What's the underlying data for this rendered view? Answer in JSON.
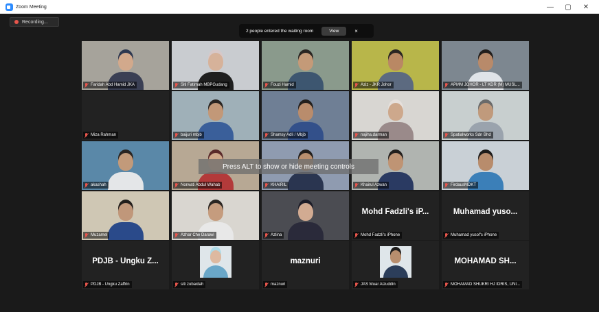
{
  "window": {
    "title": "Zoom Meeting",
    "controls": {
      "minimize": "—",
      "maximize": "▢",
      "close": "✕"
    }
  },
  "recording": {
    "label": "Recording..."
  },
  "waiting_notice": {
    "text": "2 people entered the waiting room",
    "view_label": "View",
    "close_label": "×"
  },
  "overlay": {
    "text": "Press ALT to show or hide meeting controls"
  },
  "participants": [
    {
      "name": "Faridah Abd Hamid JKA",
      "type": "video",
      "bg": "#a6a39b",
      "skin": "#d2a98c",
      "top": "#3a3f54",
      "head": "#2e3850"
    },
    {
      "name": "Siti Fatimah MBPGudang",
      "type": "video",
      "bg": "#c9ccd0",
      "skin": "#d6b29a",
      "top": "#1f1f1f",
      "head": "#d7c8c8"
    },
    {
      "name": "Fouzi Hamid",
      "type": "video",
      "bg": "#8a9a8c",
      "skin": "#c49a78",
      "top": "#3d5670",
      "head": "#2a2522"
    },
    {
      "name": "Aziz - JKR Johor",
      "type": "video",
      "bg": "#b8b64a",
      "skin": "#b98864",
      "top": "#5c6a80",
      "head": "#2a2522"
    },
    {
      "name": "APMM JOHOR - LT KDR (M) MUSL...",
      "type": "video",
      "bg": "#7d8790",
      "skin": "#b88a6a",
      "top": "#dfe3e8",
      "head": "#221e1c"
    },
    {
      "name": "Miza Rahman",
      "type": "blank"
    },
    {
      "name": "baijuri mbjb",
      "type": "video",
      "bg": "#9fb0b8",
      "skin": "#c29878",
      "top": "#3a5f9a",
      "head": "#2a2522"
    },
    {
      "name": "Shamsy Adli / Mbjb",
      "type": "video",
      "bg": "#6f7f95",
      "skin": "#b98c6c",
      "top": "#33508a",
      "head": "#231f1d"
    },
    {
      "name": "najiha.darman",
      "type": "video",
      "bg": "#d8d6d2",
      "skin": "#cda88c",
      "top": "#9a8a8a",
      "head": "#e6e0dc"
    },
    {
      "name": "Spatialworks Sdn Bhd",
      "type": "video",
      "bg": "#c8cfcf",
      "skin": "#c09a7c",
      "top": "#9aa3ad",
      "head": "#6a6a6a"
    },
    {
      "name": "akashah",
      "type": "video",
      "bg": "#5a88a8",
      "skin": "#c29a7a",
      "top": "#e4e6e8",
      "head": "#2a2522"
    },
    {
      "name": "Norwati Abdul Wahab",
      "type": "video",
      "bg": "#b7a894",
      "skin": "#cfa88a",
      "top": "#b33a3a",
      "head": "#5a2a2a"
    },
    {
      "name": "KHAIRIL",
      "type": "video",
      "bg": "#8f9bb0",
      "skin": "#b88e6e",
      "top": "#2a3550",
      "head": "#221e1c"
    },
    {
      "name": "Khairul Azwan",
      "type": "video",
      "bg": "#b0b4b0",
      "skin": "#bf9474",
      "top": "#2a3a62",
      "head": "#231f1d"
    },
    {
      "name": "FirdausMDKT",
      "type": "video",
      "bg": "#c9d0d6",
      "skin": "#b88c6c",
      "top": "#3b7fb8",
      "head": "#1e1c1b"
    },
    {
      "name": "Muzamel",
      "type": "video",
      "bg": "#cfc7b4",
      "skin": "#c0977a",
      "top": "#2a4a8a",
      "head": "#221e1c"
    },
    {
      "name": "Azhar Che Darawi",
      "type": "video",
      "bg": "#d9d6d0",
      "skin": "#c59c7e",
      "top": "#e8e8e8",
      "head": "#2a2522"
    },
    {
      "name": "Azlina",
      "type": "video",
      "bg": "#4b4c52",
      "skin": "#d2ab92",
      "top": "#2a2a3a",
      "head": "#1d1d28"
    },
    {
      "name": "Mohd Fadzli's iPhone",
      "type": "name",
      "display": "Mohd Fadzli's iP..."
    },
    {
      "name": "Muhamad yusof's iPhone",
      "type": "name",
      "display": "Muhamad yuso..."
    },
    {
      "name": "PDJB - Ungku Zaffrin",
      "type": "name",
      "display": "PDJB - Ungku Z..."
    },
    {
      "name": "siti zubaidah",
      "type": "photo",
      "skin": "#ddb9a0",
      "top": "#6aa7c8",
      "head": "#aedbe8"
    },
    {
      "name": "maznuri",
      "type": "name",
      "display": "maznuri"
    },
    {
      "name": "JAS Muar Aizuddin",
      "type": "photo",
      "skin": "#b88e6e",
      "top": "#2c3e5a",
      "head": "#1e1c1b"
    },
    {
      "name": "MOHAMAD SHUKRI HJ IDRIS, UNI...",
      "type": "name",
      "display": "MOHAMAD SH..."
    }
  ]
}
